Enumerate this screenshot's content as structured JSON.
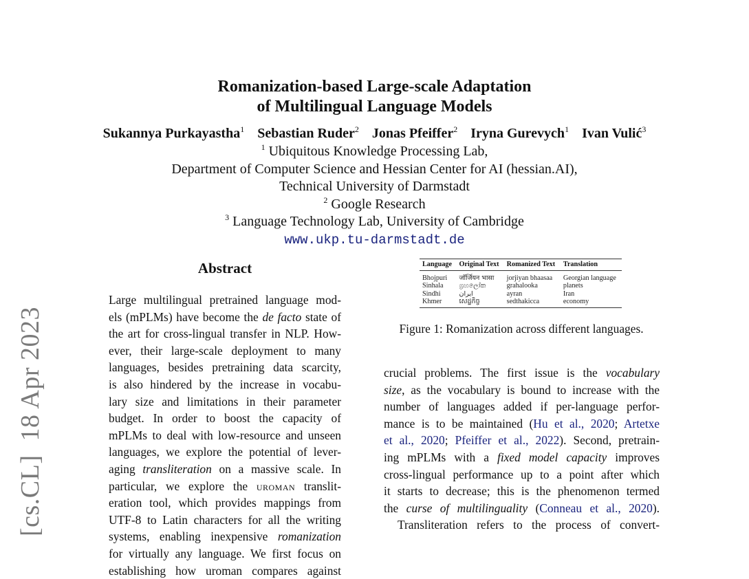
{
  "arxiv_stamp": {
    "category": "[cs.CL]",
    "date": "18 Apr 2023"
  },
  "paper": {
    "title_line1": "Romanization-based Large-scale Adaptation",
    "title_line2": "of Multilingual Language Models",
    "authors": [
      {
        "name": "Sukannya Purkayastha",
        "affil": "1"
      },
      {
        "name": "Sebastian Ruder",
        "affil": "2"
      },
      {
        "name": "Jonas Pfeiffer",
        "affil": "2"
      },
      {
        "name": "Iryna Gurevych",
        "affil": "1"
      },
      {
        "name": "Ivan Vulić",
        "affil": "3"
      }
    ],
    "affiliations": {
      "a1_mark": "1",
      "a1_line1": " Ubiquitous Knowledge Processing Lab,",
      "a1_line2": "Department of Computer Science and Hessian Center for AI (hessian.AI),",
      "a1_line3": "Technical University of Darmstadt",
      "a2_mark": "2",
      "a2_line": " Google Research",
      "a3_mark": "3",
      "a3_line": " Language Technology Lab, University of Cambridge",
      "url": "www.ukp.tu-darmstadt.de"
    }
  },
  "abstract": {
    "heading": "Abstract",
    "lines": {
      "l1": "Large multilingual pretrained language mod-",
      "l2_a": "els (mPLMs) have become the ",
      "l2_b": "de facto",
      "l2_c": " state of",
      "l3": "the art for cross-lingual transfer in NLP. How-",
      "l4": "ever, their large-scale deployment to many",
      "l5": "languages, besides pretraining data scarcity,",
      "l6": "is also hindered by the increase in vocabu-",
      "l7": "lary size and limitations in their parameter",
      "l8": "budget.  In order to boost the capacity of",
      "l9": "mPLMs to deal with low-resource and unseen",
      "l10": "languages, we explore the potential of lever-",
      "l11_a": "aging ",
      "l11_b": "transliteration",
      "l11_c": " on a massive scale.  In",
      "l12_a": "particular, we explore the ",
      "l12_b": "uroman",
      "l12_c": " translit-",
      "l13": "eration tool, which provides mappings from",
      "l14": "UTF-8 to Latin characters for all the writing",
      "l15_a": "systems, enabling inexpensive ",
      "l15_b": "romanization",
      "l16": "for virtually any language.  We first focus on",
      "l17": "establishing how uroman compares against"
    }
  },
  "figure1": {
    "headers": [
      "Language",
      "Original Text",
      "Romanized Text",
      "Translation"
    ],
    "rows": [
      {
        "language": "Bhojpuri",
        "original": "जॉर्जियन भासा",
        "romanized": "jorjiyan bhaasaa",
        "translation": "Georgian language"
      },
      {
        "language": "Sinhala",
        "original": "ග්‍රහලෝක",
        "romanized": "grahalooka",
        "translation": "planets"
      },
      {
        "language": "Sindhi",
        "original": "ايران",
        "romanized": "ayran",
        "translation": "Iran"
      },
      {
        "language": "Khmer",
        "original": "សេដ្ឋកិច្ច",
        "romanized": "sedthakicca",
        "translation": "economy"
      }
    ],
    "caption": "Figure 1: Romanization across different languages."
  },
  "intro_right": {
    "l1_a": "crucial problems. The first issue is the ",
    "l1_b": "vocabulary",
    "l2_a": "size",
    "l2_b": ", as the vocabulary is bound to increase with the",
    "l3": "number of languages added if per-language perfor-",
    "l4_a": "mance is to be maintained (",
    "l4_cite1": "Hu et al., 2020",
    "l4_sep": "; ",
    "l4_cite2": "Artetxe",
    "l5_cite2b": "et al., 2020",
    "l5_sep": "; ",
    "l5_cite3": "Pfeiffer et al., 2022",
    "l5_b": "). Second, pretrain-",
    "l6_a": "ing mPLMs with a ",
    "l6_b": "fixed model capacity",
    "l6_c": " improves",
    "l7": "cross-lingual performance up to a point after which",
    "l8": "it starts to decrease; this is the phenomenon termed",
    "l9_a": "the ",
    "l9_b": "curse of multilinguality",
    "l9_c": " (",
    "l9_cite": "Conneau et al., 2020",
    "l9_d": ").",
    "l10": "Transliteration refers to the process of convert-"
  }
}
